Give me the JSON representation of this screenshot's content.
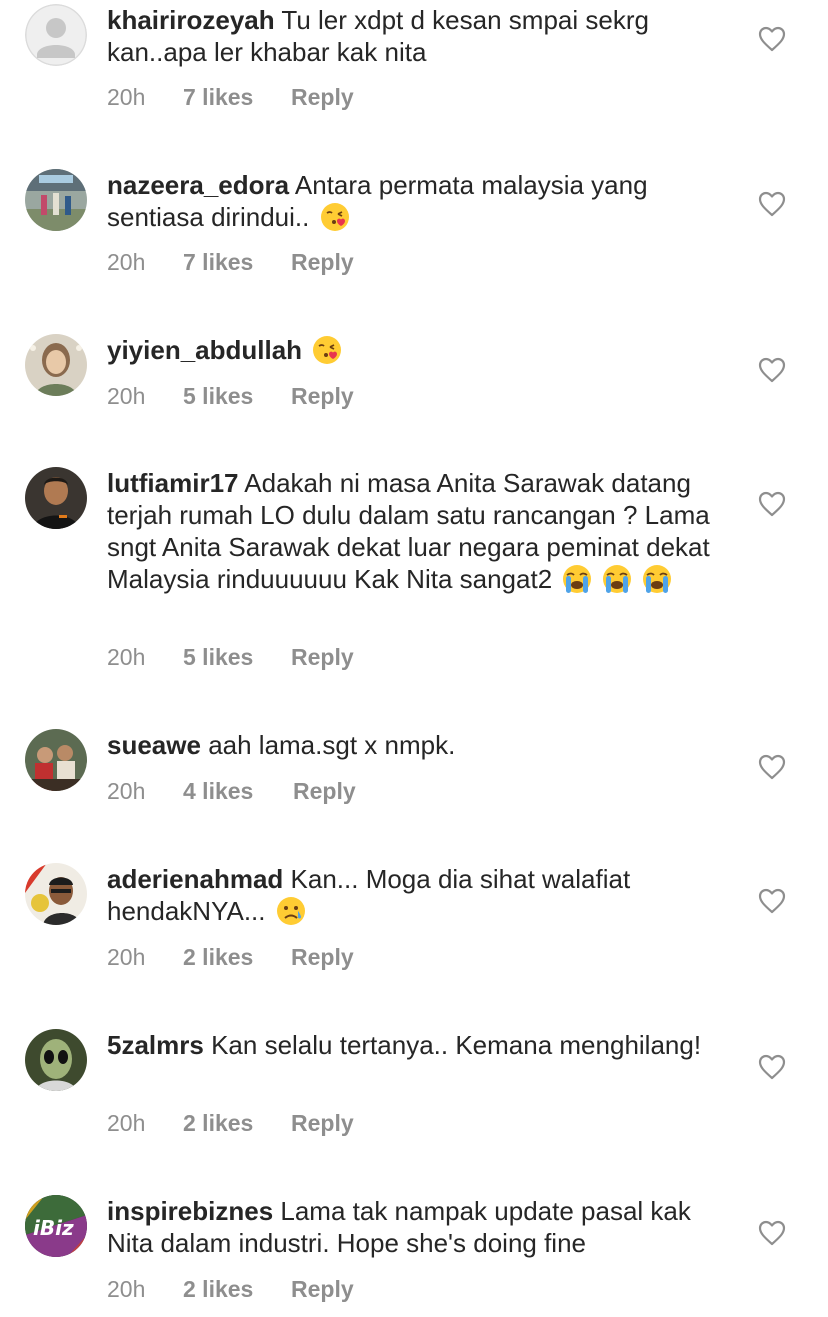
{
  "comments": [
    {
      "username": "khairirozeyah",
      "text": "Tu ler xdpt d kesan smpai sekrg kan..apa ler khabar kak nita",
      "emoji": "",
      "time": "20h",
      "likes": "7 likes",
      "reply": "Reply",
      "avatar": "default-avatar"
    },
    {
      "username": "nazeera_edora",
      "text": "Antara permata malaysia yang sentiasa dirindui.. ",
      "emoji": "face-blowing-kiss",
      "time": "20h",
      "likes": "7 likes",
      "reply": "Reply",
      "avatar": "photo-avatar"
    },
    {
      "username": "yiyien_abdullah",
      "text": " ",
      "emoji": "face-blowing-kiss",
      "time": "20h",
      "likes": "5 likes",
      "reply": "Reply",
      "avatar": "photo-avatar"
    },
    {
      "username": "lutfiamir17",
      "text": "Adakah ni masa Anita Sarawak datang terjah rumah LO dulu dalam satu rancangan ? Lama sngt Anita Sarawak dekat luar negara peminat dekat Malaysia rinduuuuuu Kak Nita sangat2 ",
      "emoji": "loudly-crying-face x3",
      "time": "20h",
      "likes": "5 likes",
      "reply": "Reply",
      "avatar": "photo-avatar"
    },
    {
      "username": "sueawe",
      "text": "aah lama.sgt x nmpk.",
      "emoji": "",
      "time": "20h",
      "likes": "4 likes",
      "reply": "Reply",
      "avatar": "photo-avatar"
    },
    {
      "username": "aderienahmad",
      "text": "Kan... Moga dia sihat walafiat hendakNYA... ",
      "emoji": "crying-face",
      "time": "20h",
      "likes": "2 likes",
      "reply": "Reply",
      "avatar": "photo-avatar"
    },
    {
      "username": "5zalmrs",
      "text": "Kan selalu tertanya.. Kemana menghilang!",
      "emoji": "",
      "time": "20h",
      "likes": "2 likes",
      "reply": "Reply",
      "avatar": "photo-avatar"
    },
    {
      "username": "inspirebiznes",
      "text": "Lama tak nampak update pasal kak Nita dalam industri. Hope she's doing fine",
      "emoji": "",
      "time": "20h",
      "likes": "2 likes",
      "reply": "Reply",
      "avatar": "logo-avatar"
    }
  ],
  "icons": {
    "like": "heart-outline-icon"
  },
  "colors": {
    "text": "#262626",
    "meta": "#8e8e8e",
    "heart": "#8e8e8e"
  }
}
